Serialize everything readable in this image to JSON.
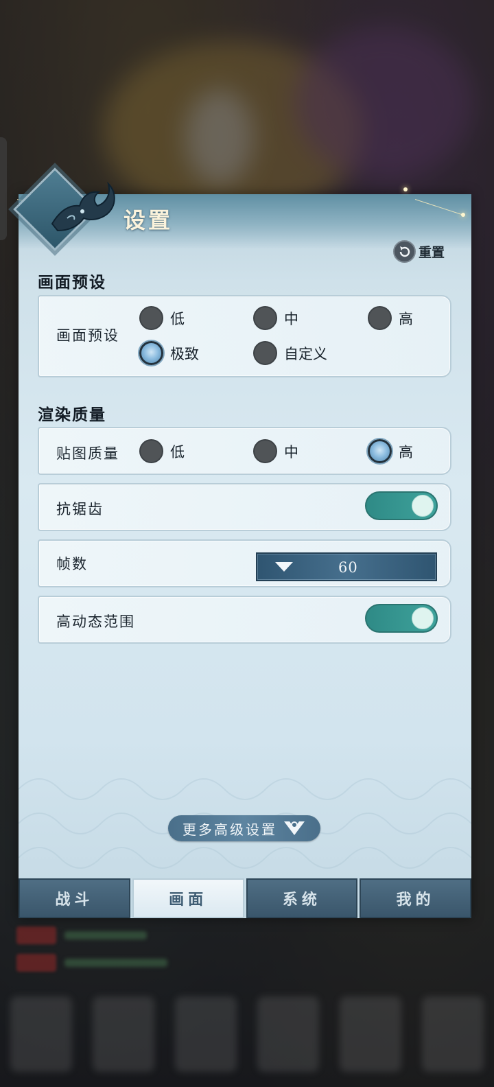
{
  "panel": {
    "title": "设置",
    "reset_label": "重置"
  },
  "preset_section": {
    "title": "画面预设",
    "row_label": "画面预设",
    "options": [
      {
        "label": "低",
        "selected": false
      },
      {
        "label": "中",
        "selected": false
      },
      {
        "label": "高",
        "selected": false
      },
      {
        "label": "极致",
        "selected": true
      },
      {
        "label": "自定义",
        "selected": false
      }
    ]
  },
  "render_section": {
    "title": "渲染质量",
    "texture": {
      "label": "贴图质量",
      "options": [
        {
          "label": "低",
          "selected": false
        },
        {
          "label": "中",
          "selected": false
        },
        {
          "label": "高",
          "selected": true
        }
      ]
    },
    "antialias": {
      "label": "抗锯齿",
      "enabled": true
    },
    "fps": {
      "label": "帧数",
      "value": "60"
    },
    "hdr": {
      "label": "高动态范围",
      "enabled": true
    }
  },
  "more_button": {
    "label": "更多高级设置"
  },
  "tabs": [
    {
      "label": "战斗",
      "active": false
    },
    {
      "label": "画面",
      "active": true
    },
    {
      "label": "系统",
      "active": false
    },
    {
      "label": "我的",
      "active": false
    }
  ],
  "colors": {
    "toggle_on": "#3ea39c",
    "tab_bg": "#3a566b",
    "accent": "#466f8d"
  }
}
